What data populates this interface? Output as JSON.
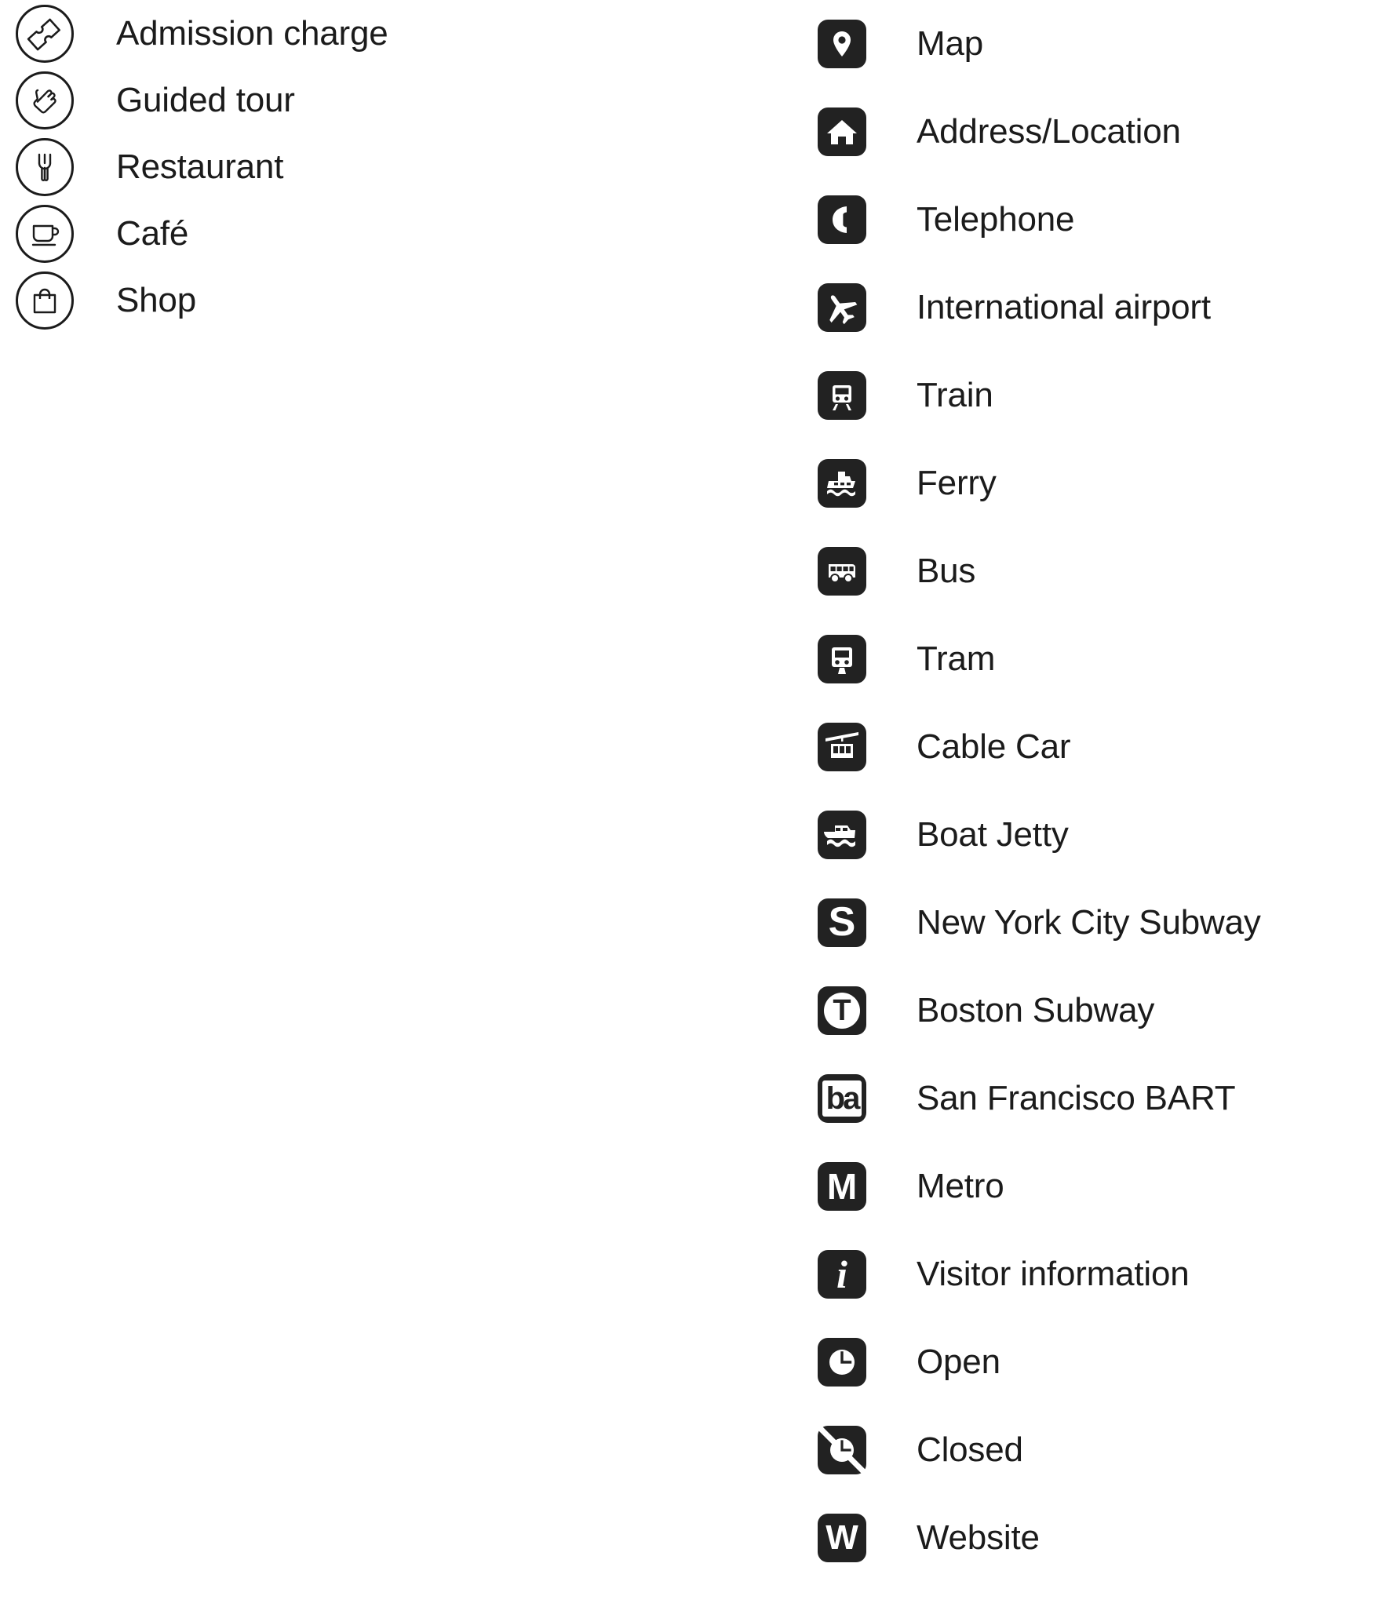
{
  "legend": {
    "left_column": [
      {
        "label": "Admission charge",
        "icon": "ticket-icon",
        "style": "outline-circle"
      },
      {
        "label": "Guided tour",
        "icon": "pointing-hand-icon",
        "style": "outline-circle"
      },
      {
        "label": "Restaurant",
        "icon": "fork-icon",
        "style": "outline-circle"
      },
      {
        "label": "Café",
        "icon": "coffee-cup-icon",
        "style": "outline-circle"
      },
      {
        "label": "Shop",
        "icon": "shopping-bag-icon",
        "style": "outline-circle"
      }
    ],
    "right_column": [
      {
        "label": "Map",
        "icon": "map-pin-icon",
        "style": "solid-square"
      },
      {
        "label": "Address/Location",
        "icon": "house-icon",
        "style": "solid-square"
      },
      {
        "label": "Telephone",
        "icon": "telephone-icon",
        "style": "solid-square"
      },
      {
        "label": "International airport",
        "icon": "airplane-icon",
        "style": "solid-square"
      },
      {
        "label": "Train",
        "icon": "train-icon",
        "style": "solid-square"
      },
      {
        "label": "Ferry",
        "icon": "ferry-icon",
        "style": "solid-square"
      },
      {
        "label": "Bus",
        "icon": "bus-icon",
        "style": "solid-square"
      },
      {
        "label": "Tram",
        "icon": "tram-icon",
        "style": "solid-square"
      },
      {
        "label": "Cable Car",
        "icon": "cable-car-icon",
        "style": "solid-square"
      },
      {
        "label": "Boat Jetty",
        "icon": "boat-jetty-icon",
        "style": "solid-square"
      },
      {
        "label": "New York City Subway",
        "icon": "letter-s-icon",
        "style": "solid-square",
        "glyph": "S"
      },
      {
        "label": "Boston Subway",
        "icon": "letter-t-circle-icon",
        "style": "solid-square",
        "glyph": "T"
      },
      {
        "label": "San Francisco BART",
        "icon": "bart-ba-icon",
        "style": "solid-square",
        "glyph": "ba"
      },
      {
        "label": "Metro",
        "icon": "letter-m-icon",
        "style": "solid-square",
        "glyph": "M"
      },
      {
        "label": "Visitor information",
        "icon": "information-i-icon",
        "style": "solid-square",
        "glyph": "i"
      },
      {
        "label": "Open",
        "icon": "clock-icon",
        "style": "solid-square"
      },
      {
        "label": "Closed",
        "icon": "clock-crossed-icon",
        "style": "solid-square"
      },
      {
        "label": "Website",
        "icon": "letter-w-icon",
        "style": "solid-square",
        "glyph": "W"
      }
    ]
  },
  "colors": {
    "icon_fill": "#222222",
    "outline": "#1b1b1b",
    "text": "#1b1b1b",
    "background": "#ffffff"
  }
}
